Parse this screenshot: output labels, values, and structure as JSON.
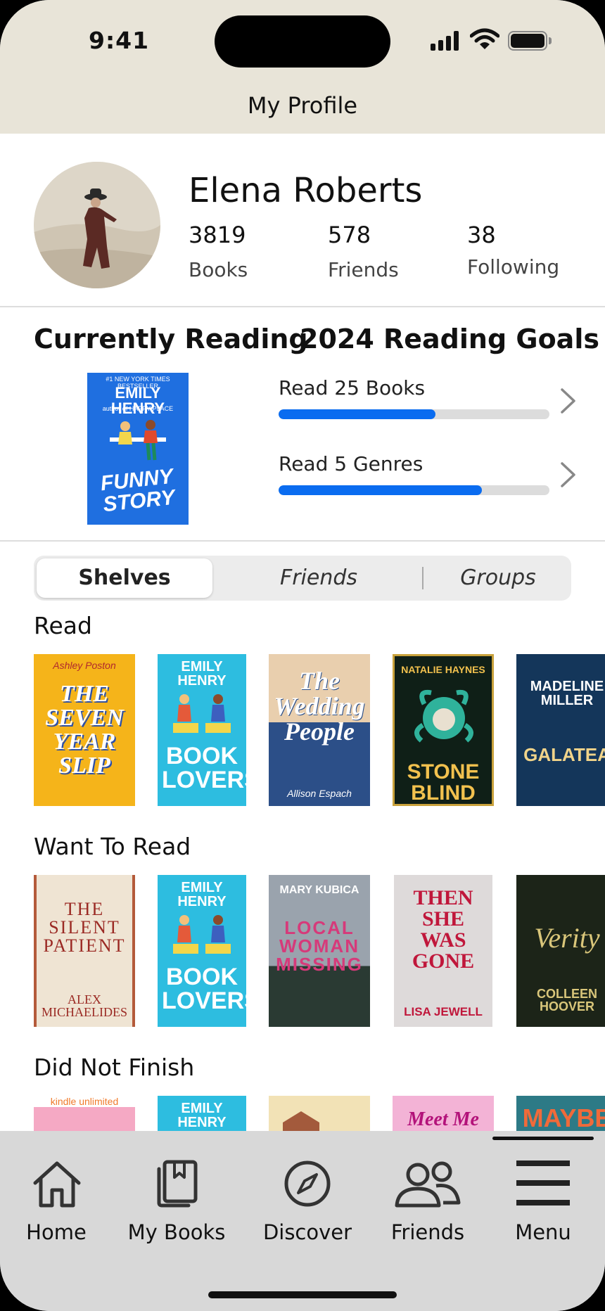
{
  "status": {
    "time": "9:41"
  },
  "header": {
    "title": "My Profile"
  },
  "profile": {
    "name": "Elena Roberts",
    "stats": [
      {
        "value": "3819",
        "label": "Books"
      },
      {
        "value": "578",
        "label": "Friends"
      },
      {
        "value": "38",
        "label": "Following"
      }
    ]
  },
  "currently_reading": {
    "title": "Currently Reading",
    "book": {
      "author": "EMILY HENRY",
      "title": "FUNNY STORY",
      "top": "#1 NEW YORK TIMES BESTSELLER",
      "sub": "author of HAPPY PLACE",
      "color": "#1f6fe0"
    }
  },
  "goals": {
    "title": "2024 Reading Goals",
    "items": [
      {
        "label": "Read 25 Books",
        "progress": 0.58
      },
      {
        "label": "Read 5 Genres",
        "progress": 0.75
      }
    ]
  },
  "tabs": {
    "items": [
      "Shelves",
      "Friends",
      "Groups"
    ],
    "active": "Shelves"
  },
  "shelves": [
    {
      "title": "Read",
      "books": [
        {
          "author": "Ashley Poston",
          "title": "THE SEVEN YEAR SLIP",
          "color": "#f5b41a",
          "text": "#ffffff"
        },
        {
          "author": "EMILY HENRY",
          "title": "BOOK LOVERS",
          "color": "#2dbde0",
          "text": "#ffffff"
        },
        {
          "author": "Allison Espach",
          "title": "The Wedding People",
          "color": "#e9cfae",
          "text": "#ffffff"
        },
        {
          "author": "NATALIE HAYNES",
          "title": "STONE BLIND",
          "color": "#0f1f17",
          "text": "#f2c14e"
        },
        {
          "author": "MADELINE MILLER",
          "title": "GALATEA",
          "color": "#14365a",
          "text": "#f1d48a"
        }
      ]
    },
    {
      "title": "Want To Read",
      "books": [
        {
          "author": "ALEX MICHAELIDES",
          "title": "THE SILENT PATIENT",
          "color": "#efe4d3",
          "text": "#9b2a24"
        },
        {
          "author": "EMILY HENRY",
          "title": "BOOK LOVERS",
          "color": "#2dbde0",
          "text": "#ffffff"
        },
        {
          "author": "MARY KUBICA",
          "title": "LOCAL WOMAN MISSING",
          "color": "#7c8794",
          "text": "#d63a7a"
        },
        {
          "author": "LISA JEWELL",
          "title": "THEN SHE WAS GONE",
          "color": "#dedada",
          "text": "#c0173b"
        },
        {
          "author": "COLLEEN HOOVER",
          "title": "Verity",
          "color": "#1c2418",
          "text": "#d9c67a"
        }
      ]
    },
    {
      "title": "Did Not Finish",
      "books": [
        {
          "author": "kindle unlimited",
          "title": "",
          "color": "#f5a9c4",
          "text": "#ffffff"
        },
        {
          "author": "EMILY HENRY",
          "title": "",
          "color": "#2dbde0",
          "text": "#ffffff"
        },
        {
          "author": "",
          "title": "",
          "color": "#f2e2b6",
          "text": "#555555"
        },
        {
          "author": "",
          "title": "Meet Me",
          "color": "#f3b3d6",
          "text": "#b3127a"
        },
        {
          "author": "",
          "title": "MAYBE",
          "color": "#2d7a86",
          "text": "#f06a3a"
        }
      ]
    }
  ],
  "tabbar": {
    "items": [
      {
        "label": "Home",
        "icon": "home-icon"
      },
      {
        "label": "My Books",
        "icon": "books-icon"
      },
      {
        "label": "Discover",
        "icon": "compass-icon"
      },
      {
        "label": "Friends",
        "icon": "friends-icon"
      },
      {
        "label": "Menu",
        "icon": "menu-icon"
      }
    ],
    "active": "Menu"
  }
}
